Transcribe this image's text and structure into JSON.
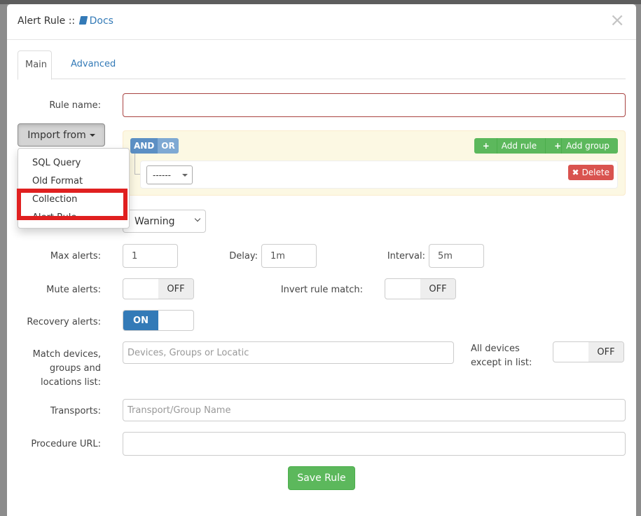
{
  "modal": {
    "title_prefix": "Alert Rule ::",
    "docs_label": "Docs",
    "close_symbol": "×"
  },
  "tabs": [
    {
      "label": "Main",
      "active": true
    },
    {
      "label": "Advanced",
      "active": false
    }
  ],
  "form": {
    "rule_name_label": "Rule name:",
    "rule_name_value": "",
    "import_label": "Import from",
    "import_menu": [
      "SQL Query",
      "Old Format",
      "Collection",
      "Alert Rule"
    ],
    "builder": {
      "and_label": "AND",
      "or_label": "OR",
      "add_rule_label": "Add rule",
      "add_group_label": "Add group",
      "rule_select_value": "------",
      "delete_label": "Delete"
    },
    "severity_value": "Warning",
    "max_alerts_label": "Max alerts:",
    "max_alerts_value": "1",
    "delay_label": "Delay:",
    "delay_value": "1m",
    "interval_label": "Interval:",
    "interval_value": "5m",
    "mute_alerts_label": "Mute alerts:",
    "mute_alerts_state": "OFF",
    "invert_label": "Invert rule match:",
    "invert_state": "OFF",
    "recovery_label": "Recovery alerts:",
    "recovery_state": "ON",
    "match_label_line1": "Match devices,",
    "match_label_line2": "groups and",
    "match_label_line3": "locations list:",
    "match_placeholder": "Devices, Groups or Locatic",
    "all_devices_line1": "All devices",
    "all_devices_line2": "except in list:",
    "all_devices_state": "OFF",
    "transports_label": "Transports:",
    "transports_placeholder": "Transport/Group Name",
    "procedure_label": "Procedure URL:",
    "procedure_value": "",
    "save_label": "Save Rule"
  },
  "highlight_color": "#e02020",
  "accent_color": "#337ab7",
  "success_color": "#5cb85c",
  "danger_color": "#d9534f"
}
